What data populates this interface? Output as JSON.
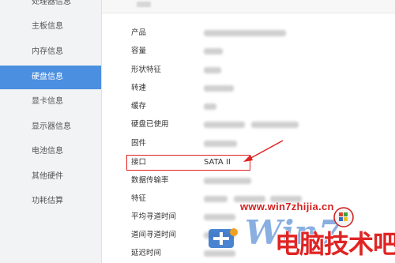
{
  "sidebar": {
    "items": [
      {
        "label": "处理器信息",
        "active": false
      },
      {
        "label": "主板信息",
        "active": false
      },
      {
        "label": "内存信息",
        "active": false
      },
      {
        "label": "硬盘信息",
        "active": true
      },
      {
        "label": "显卡信息",
        "active": false
      },
      {
        "label": "显示器信息",
        "active": false
      },
      {
        "label": "电池信息",
        "active": false
      },
      {
        "label": "其他硬件",
        "active": false
      },
      {
        "label": "功耗估算",
        "active": false
      }
    ]
  },
  "details": {
    "rows": [
      {
        "label": "产品"
      },
      {
        "label": "容量"
      },
      {
        "label": "形状特征"
      },
      {
        "label": "转速"
      },
      {
        "label": "缓存"
      },
      {
        "label": "硬盘已使用"
      },
      {
        "label": "固件"
      },
      {
        "label": "接口",
        "value": "SATA II"
      },
      {
        "label": "数据传输率"
      },
      {
        "label": "特征"
      },
      {
        "label": "平均寻道时间"
      },
      {
        "label": "道间寻道时间"
      },
      {
        "label": "延迟时间"
      }
    ]
  },
  "annotation": {
    "color": "#e02020"
  },
  "watermark": {
    "url": "www.win7zhijia.cn",
    "brand": "Win7",
    "text": "电脑技术吧"
  },
  "colors": {
    "accent": "#4b8fe0",
    "sidebar_bg": "#f2f3f5"
  }
}
